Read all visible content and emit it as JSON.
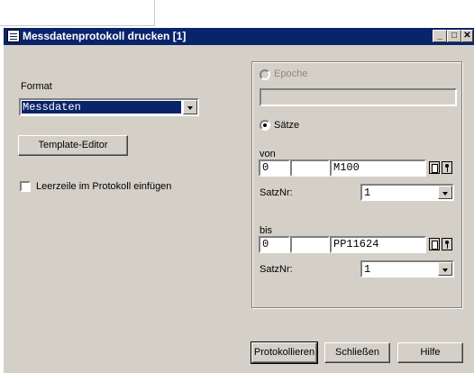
{
  "window": {
    "title": "Messdatenprotokoll drucken [1]",
    "minimize": "_",
    "maximize": "□",
    "close": "✕"
  },
  "left": {
    "format_label": "Format",
    "format_value": "Messdaten",
    "template_button": "Template-Editor",
    "checkbox_label": "Leerzeile im Protokoll einfügen"
  },
  "right": {
    "epoche_label": "Epoche",
    "saetze_label": "Sätze",
    "von_label": "von",
    "von_field1": "0",
    "von_field2": "",
    "von_point": "M100",
    "satznr_label": "SatzNr:",
    "von_satznr": "1",
    "bis_label": "bis",
    "bis_field1": "0",
    "bis_field2": "",
    "bis_point": "PP11624",
    "bis_satznr": "1"
  },
  "buttons": {
    "protokollieren": "Protokollieren",
    "schliessen": "Schließen",
    "hilfe": "Hilfe"
  }
}
